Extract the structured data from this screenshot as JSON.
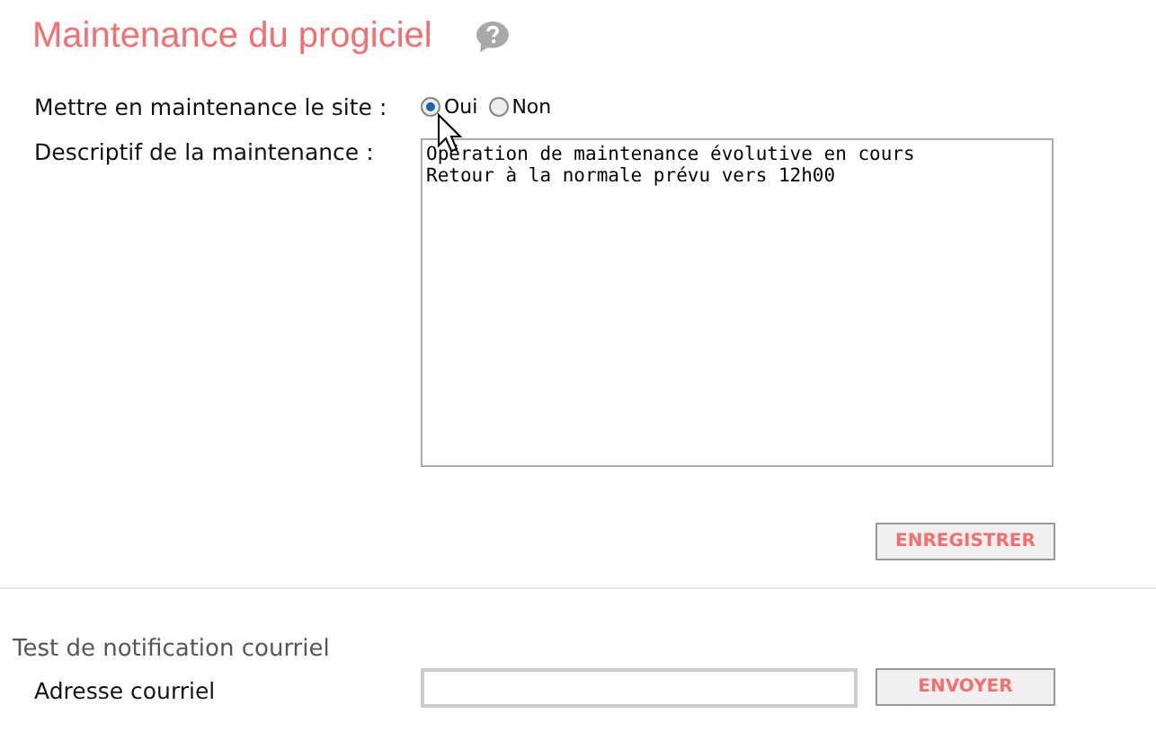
{
  "title": "Maintenance du progiciel",
  "maintenance": {
    "label": "Mettre en maintenance le site :",
    "options": [
      {
        "label": "Oui",
        "selected": true
      },
      {
        "label": "Non",
        "selected": false
      }
    ]
  },
  "description": {
    "label": "Descriptif de la maintenance :",
    "value": "Opération de maintenance évolutive en cours\nRetour à la normale prévu vers 12h00"
  },
  "save_button": "ENREGISTRER",
  "notification": {
    "title": "Test de notification courriel",
    "label": "Adresse courriel",
    "send_button": "ENVOYER"
  }
}
